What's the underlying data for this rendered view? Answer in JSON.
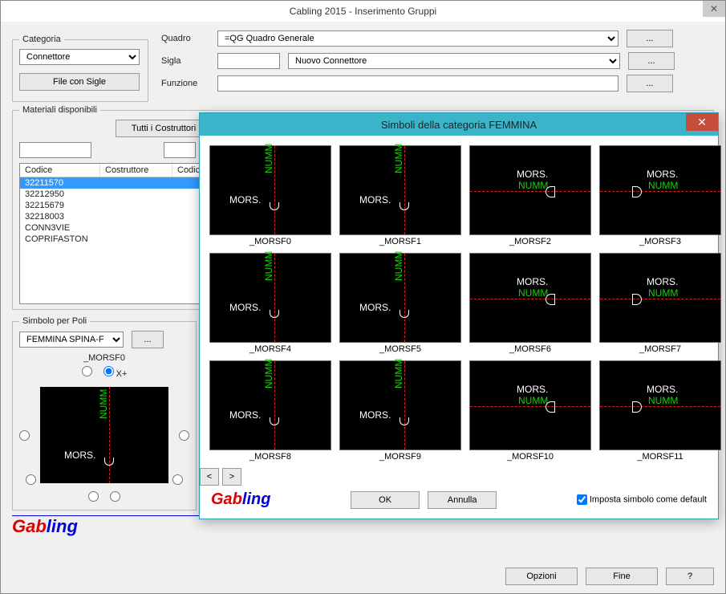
{
  "main": {
    "title": "Cabling 2015 - Inserimento Gruppi",
    "categoria_label": "Categoria",
    "categoria_value": "Connettore",
    "file_sigle_btn": "File con Sigle",
    "quadro_label": "Quadro",
    "quadro_code": "=QG",
    "quadro_desc": "Quadro Generale",
    "sigla_label": "Sigla",
    "sigla_value": "",
    "sigla_desc": "Nuovo Connettore",
    "funzione_label": "Funzione",
    "funzione_value": "",
    "ellipsis": "...",
    "materiali_legend": "Materiali disponibili",
    "tutti_costruttori_btn": "Tutti i Costruttori",
    "col_codice": "Codice",
    "col_costruttore": "Costruttore",
    "materiali": [
      "32211570",
      "32212950",
      "32215679",
      "32218003",
      "CONN3VIE",
      "COPRIFASTON"
    ],
    "simbolo_legend": "Simbolo per Poli",
    "simbolo_select": "FEMMINA   SPINA-F",
    "current_symbol": "_MORSF0",
    "xplus": "X+",
    "preview_mors": "MORS.",
    "preview_numm": "NUMM",
    "opzioni": "Opzioni",
    "fine": "Fine",
    "help": "?"
  },
  "modal": {
    "title": "Simboli della categoria FEMMINA",
    "symbols": [
      "_MORSF0",
      "_MORSF1",
      "_MORSF2",
      "_MORSF3",
      "_MORSF4",
      "_MORSF5",
      "_MORSF6",
      "_MORSF7",
      "_MORSF8",
      "_MORSF9",
      "_MORSF10",
      "_MORSF11"
    ],
    "mors_label": "MORS.",
    "numm_label": "NUMM",
    "prev": "<",
    "next": ">",
    "ok": "OK",
    "annulla": "Annulla",
    "default_check": "Imposta simbolo come default",
    "default_checked": true
  },
  "logo": {
    "p1": "Gab",
    "p2": "ling"
  }
}
